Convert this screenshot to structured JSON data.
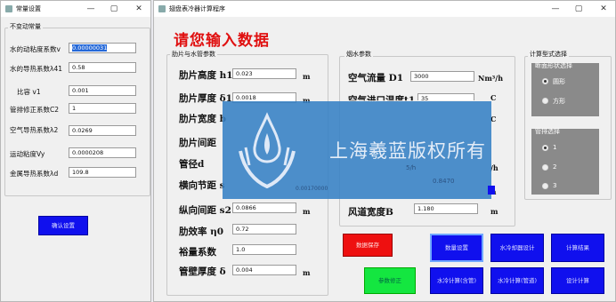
{
  "left_window": {
    "title": "常量设置",
    "group_title": "不变动常量",
    "fields": [
      {
        "label": "水的动粘度系数v",
        "value": "0.00000031"
      },
      {
        "label": "水的导热系数λ41",
        "value": "0.58"
      },
      {
        "label": "比容  v1",
        "value": "0.001"
      },
      {
        "label": "管排修正系数C2",
        "value": "1"
      },
      {
        "label": "空气导热系数λ2",
        "value": "0.0269"
      },
      {
        "label": "运动粘度Vy",
        "value": "0.0000208"
      },
      {
        "label": "金属导热系数λd",
        "value": "109.8"
      }
    ],
    "save_button": "确认设置"
  },
  "main_window": {
    "title": "翅盘表冷器计算程序",
    "heading": "请您输入数据",
    "fin_group_title": "肋片与水管参数",
    "fin_fields": [
      {
        "label": "肋片高度 h1",
        "value": "0.023",
        "unit": "m"
      },
      {
        "label": "肋片厚度  δ1",
        "value": "0.0018",
        "unit": "m"
      },
      {
        "label": "肋片宽度  b",
        "value": "",
        "unit": ""
      },
      {
        "label": "肋片间距",
        "value": "",
        "unit": ""
      },
      {
        "label": "管径d",
        "value": "",
        "unit": ""
      },
      {
        "label": "横向节距  s",
        "value": "",
        "unit": ""
      },
      {
        "label": "纵向间距  s2",
        "value": "0.0866",
        "unit": "m"
      },
      {
        "label": "肋效率 η0",
        "value": "0.72",
        "unit": ""
      },
      {
        "label": "裕量系数",
        "value": "1.0",
        "unit": ""
      },
      {
        "label": "管壁厚度 δ",
        "value": "0.004",
        "unit": "m"
      }
    ],
    "smoke_group_title": "烟水参数",
    "smoke_fields": [
      {
        "label": "空气流量 D1",
        "value": "3000",
        "unit": "Nm³/h"
      },
      {
        "label": "空气进口温度t1",
        "value": "35",
        "unit": "℃"
      },
      {
        "label": "风道宽度B",
        "value": "1.180",
        "unit": "m"
      }
    ],
    "smoke_units_partial": [
      "C",
      "C",
      "/h",
      "m"
    ],
    "smoke_hidden_values": [
      "5/h",
      "0.8470"
    ],
    "calc_group_title": "计算型式选择",
    "section_group_title": "断面形状选择",
    "section_options": [
      "圆形",
      "方形"
    ],
    "tube_group_title": "管排选择",
    "tube_options": [
      "1",
      "2",
      "3"
    ],
    "hidden_fin_spacing_value": "0.00170000",
    "buttons": {
      "save_data": "数据保存",
      "param_fix": "参数修正",
      "b1": "数量设置",
      "b2": "水冷却器设计",
      "b3": "计算结果",
      "b4": "水冷计算(含管)",
      "b5": "水冷计算(管道)",
      "b6": "设计计算"
    }
  },
  "watermark": {
    "text": "上海羲蓝版权所有"
  }
}
